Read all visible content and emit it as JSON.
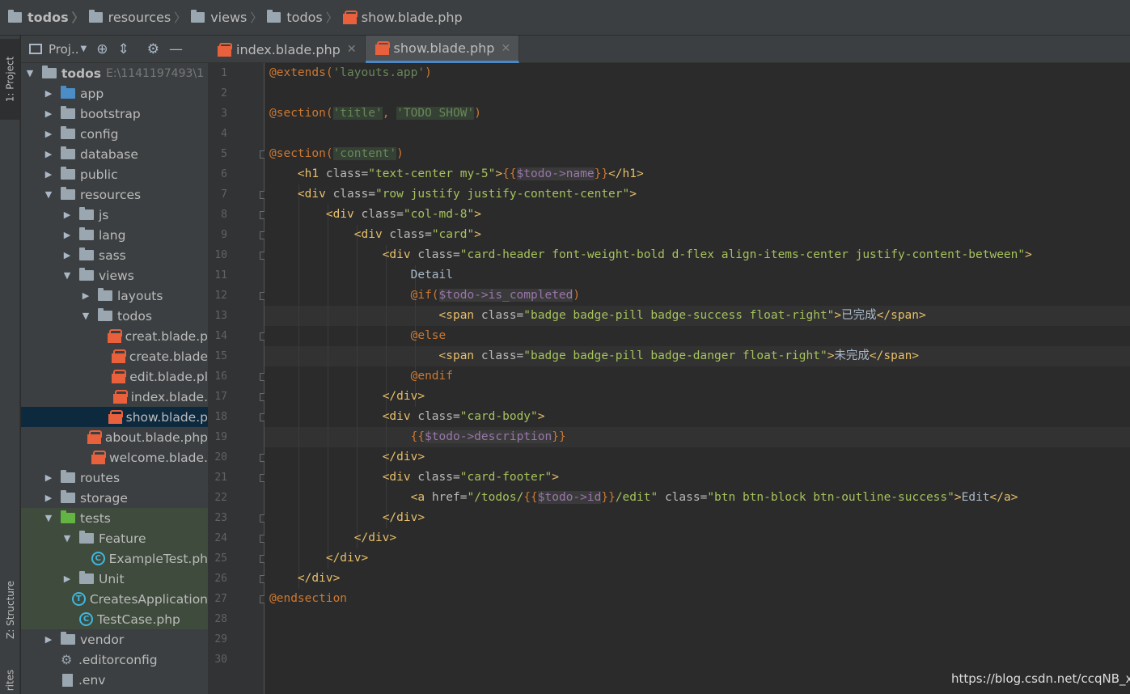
{
  "breadcrumb": [
    "todos",
    "resources",
    "views",
    "todos",
    "show.blade.php"
  ],
  "toolstrip": {
    "project_tab": "1: Project",
    "structure_tab": "Z: Structure",
    "favorites_tab": "rites"
  },
  "project_panel": {
    "title": "Proj..",
    "root_name": "todos",
    "root_path": "E:\\1141197493\\1"
  },
  "tree": [
    {
      "label": "app",
      "depth": 1,
      "type": "folder-blue",
      "arrow": "▶"
    },
    {
      "label": "bootstrap",
      "depth": 1,
      "type": "folder",
      "arrow": "▶"
    },
    {
      "label": "config",
      "depth": 1,
      "type": "folder",
      "arrow": "▶"
    },
    {
      "label": "database",
      "depth": 1,
      "type": "folder",
      "arrow": "▶"
    },
    {
      "label": "public",
      "depth": 1,
      "type": "folder",
      "arrow": "▶"
    },
    {
      "label": "resources",
      "depth": 1,
      "type": "folder",
      "arrow": "▼"
    },
    {
      "label": "js",
      "depth": 2,
      "type": "folder",
      "arrow": "▶"
    },
    {
      "label": "lang",
      "depth": 2,
      "type": "folder",
      "arrow": "▶"
    },
    {
      "label": "sass",
      "depth": 2,
      "type": "folder",
      "arrow": "▶"
    },
    {
      "label": "views",
      "depth": 2,
      "type": "folder",
      "arrow": "▼"
    },
    {
      "label": "layouts",
      "depth": 3,
      "type": "folder",
      "arrow": "▶"
    },
    {
      "label": "todos",
      "depth": 3,
      "type": "folder",
      "arrow": "▼"
    },
    {
      "label": "creat.blade.p",
      "depth": 4,
      "type": "blade"
    },
    {
      "label": "create.blade",
      "depth": 4,
      "type": "blade"
    },
    {
      "label": "edit.blade.pl",
      "depth": 4,
      "type": "blade"
    },
    {
      "label": "index.blade.",
      "depth": 4,
      "type": "blade"
    },
    {
      "label": "show.blade.p",
      "depth": 4,
      "type": "blade",
      "selected": true
    },
    {
      "label": "about.blade.php",
      "depth": 3,
      "type": "blade"
    },
    {
      "label": "welcome.blade.",
      "depth": 3,
      "type": "blade"
    },
    {
      "label": "routes",
      "depth": 1,
      "type": "folder",
      "arrow": "▶"
    },
    {
      "label": "storage",
      "depth": 1,
      "type": "folder",
      "arrow": "▶"
    },
    {
      "label": "tests",
      "depth": 1,
      "type": "folder-green",
      "arrow": "▼",
      "green": true
    },
    {
      "label": "Feature",
      "depth": 2,
      "type": "folder",
      "arrow": "▼",
      "green": true
    },
    {
      "label": "ExampleTest.ph",
      "depth": 3,
      "type": "circle-c",
      "green": true
    },
    {
      "label": "Unit",
      "depth": 2,
      "type": "folder",
      "arrow": "▶",
      "green": true
    },
    {
      "label": "CreatesApplication",
      "depth": 2,
      "type": "circle-t",
      "green": true
    },
    {
      "label": "TestCase.php",
      "depth": 2,
      "type": "circle-c",
      "green": true
    },
    {
      "label": "vendor",
      "depth": 1,
      "type": "folder",
      "arrow": "▶"
    },
    {
      "label": ".editorconfig",
      "depth": 1,
      "type": "gear"
    },
    {
      "label": ".env",
      "depth": 1,
      "type": "file"
    }
  ],
  "tabs": [
    {
      "label": "index.blade.php",
      "active": false
    },
    {
      "label": "show.blade.php",
      "active": true
    }
  ],
  "line_numbers": [
    "1",
    "2",
    "3",
    "4",
    "5",
    "6",
    "7",
    "8",
    "9",
    "10",
    "11",
    "12",
    "13",
    "14",
    "15",
    "16",
    "17",
    "18",
    "19",
    "20",
    "21",
    "22",
    "23",
    "24",
    "25",
    "26",
    "27",
    "28",
    "29",
    "30"
  ],
  "code": [
    [
      [
        "k-dir",
        "@extends("
      ],
      [
        "k-str",
        "'layouts.app'"
      ],
      [
        "k-dir",
        ")"
      ]
    ],
    [],
    [
      [
        "k-dir",
        "@section("
      ],
      [
        "k-strbg",
        "'title'"
      ],
      [
        "k-dir",
        ", "
      ],
      [
        "k-strbg",
        "'TODO SHOW'"
      ],
      [
        "k-dir",
        ")"
      ]
    ],
    [],
    [
      [
        "k-dir",
        "@section("
      ],
      [
        "k-strbg",
        "'content'"
      ],
      [
        "k-dir",
        ")"
      ]
    ],
    [
      [
        "k-plain",
        "    "
      ],
      [
        "k-tag",
        "<h1 "
      ],
      [
        "k-attr",
        "class="
      ],
      [
        "k-aval",
        "\"text-center my-5\""
      ],
      [
        "k-tag",
        ">"
      ],
      [
        "k-brace",
        "{{"
      ],
      [
        "k-varbg",
        "$todo->"
      ],
      [
        "k-varbg",
        "name"
      ],
      [
        "k-brace",
        "}}"
      ],
      [
        "k-tag",
        "</h1>"
      ]
    ],
    [
      [
        "k-plain",
        "    "
      ],
      [
        "k-tag",
        "<div "
      ],
      [
        "k-attr",
        "class="
      ],
      [
        "k-aval",
        "\"row justify justify-content-center\""
      ],
      [
        "k-tag",
        ">"
      ]
    ],
    [
      [
        "k-plain",
        "        "
      ],
      [
        "k-tag",
        "<div "
      ],
      [
        "k-attr",
        "class="
      ],
      [
        "k-aval",
        "\"col-md-8\""
      ],
      [
        "k-tag",
        ">"
      ]
    ],
    [
      [
        "k-plain",
        "            "
      ],
      [
        "k-tag",
        "<div "
      ],
      [
        "k-attr",
        "class="
      ],
      [
        "k-aval",
        "\"card\""
      ],
      [
        "k-tag",
        ">"
      ]
    ],
    [
      [
        "k-plain",
        "                "
      ],
      [
        "k-tag",
        "<div "
      ],
      [
        "k-attr",
        "class="
      ],
      [
        "k-aval",
        "\"card-header font-weight-bold d-flex align-items-center justify-content-between\""
      ],
      [
        "k-tag",
        ">"
      ]
    ],
    [
      [
        "k-plain",
        "                    "
      ],
      [
        "k-txt",
        "Detail"
      ]
    ],
    [
      [
        "k-plain",
        "                    "
      ],
      [
        "k-dir",
        "@if("
      ],
      [
        "k-varbg",
        "$todo->is_completed"
      ],
      [
        "k-dir",
        ")"
      ]
    ],
    [
      [
        "k-plain",
        "                        "
      ],
      [
        "k-tag",
        "<span "
      ],
      [
        "k-attr",
        "class="
      ],
      [
        "k-aval",
        "\"badge badge-pill badge-success float-right\""
      ],
      [
        "k-tag",
        ">"
      ],
      [
        "k-txt",
        "已完成"
      ],
      [
        "k-tag",
        "</span>"
      ]
    ],
    [
      [
        "k-plain",
        "                    "
      ],
      [
        "k-dir",
        "@else"
      ]
    ],
    [
      [
        "k-plain",
        "                        "
      ],
      [
        "k-tag",
        "<span "
      ],
      [
        "k-attr",
        "class="
      ],
      [
        "k-aval",
        "\"badge badge-pill badge-danger float-right\""
      ],
      [
        "k-tag",
        ">"
      ],
      [
        "k-txt",
        "未完成"
      ],
      [
        "k-tag",
        "</span>"
      ]
    ],
    [
      [
        "k-plain",
        "                    "
      ],
      [
        "k-dir",
        "@endif"
      ]
    ],
    [
      [
        "k-plain",
        "                "
      ],
      [
        "k-tag",
        "</div>"
      ]
    ],
    [
      [
        "k-plain",
        "                "
      ],
      [
        "k-tag",
        "<div "
      ],
      [
        "k-attr",
        "class="
      ],
      [
        "k-aval",
        "\"card-body\""
      ],
      [
        "k-tag",
        ">"
      ]
    ],
    [
      [
        "k-plain",
        "                    "
      ],
      [
        "k-brace",
        "{{"
      ],
      [
        "k-varbg",
        "$todo->description"
      ],
      [
        "k-brace",
        "}}"
      ]
    ],
    [
      [
        "k-plain",
        "                "
      ],
      [
        "k-tag",
        "</div>"
      ]
    ],
    [
      [
        "k-plain",
        "                "
      ],
      [
        "k-tag",
        "<div "
      ],
      [
        "k-attr",
        "class="
      ],
      [
        "k-aval",
        "\"card-footer\""
      ],
      [
        "k-tag",
        ">"
      ]
    ],
    [
      [
        "k-plain",
        "                    "
      ],
      [
        "k-tag",
        "<a "
      ],
      [
        "k-attr",
        "href="
      ],
      [
        "k-aval",
        "\"/todos/"
      ],
      [
        "k-brace",
        "{{"
      ],
      [
        "k-varbg",
        "$todo->id"
      ],
      [
        "k-brace",
        "}}"
      ],
      [
        "k-aval",
        "/edit\" "
      ],
      [
        "k-attr",
        "class="
      ],
      [
        "k-aval",
        "\"btn btn-block btn-outline-success\""
      ],
      [
        "k-tag",
        ">"
      ],
      [
        "k-txt",
        "Edit"
      ],
      [
        "k-tag",
        "</a>"
      ]
    ],
    [
      [
        "k-plain",
        "                "
      ],
      [
        "k-tag",
        "</div>"
      ]
    ],
    [
      [
        "k-plain",
        "            "
      ],
      [
        "k-tag",
        "</div>"
      ]
    ],
    [
      [
        "k-plain",
        "        "
      ],
      [
        "k-tag",
        "</div>"
      ]
    ],
    [
      [
        "k-plain",
        "    "
      ],
      [
        "k-tag",
        "</div>"
      ]
    ],
    [
      [
        "k-dir",
        "@endsection"
      ]
    ],
    [],
    [],
    []
  ],
  "watermark": "https://blog.csdn.net/ccqNB_x",
  "colors": {
    "accent": "#4a88c7",
    "selection": "#0d293e",
    "tests_bg": "#3f4b3c",
    "blade": "#e8613c"
  }
}
